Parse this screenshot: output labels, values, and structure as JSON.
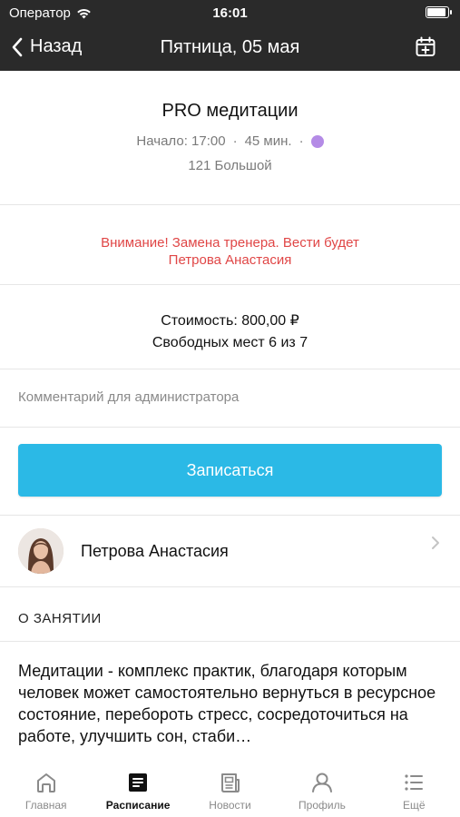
{
  "status_bar": {
    "carrier": "Оператор",
    "time": "16:01",
    "battery_level": 0.9
  },
  "nav": {
    "back_label": "Назад",
    "title": "Пятница, 05 мая"
  },
  "class_info": {
    "title": "PRO медитации",
    "start": "Начало: 17:00",
    "separator": "·",
    "duration": "45 мин.",
    "color": "#b48be6",
    "room": "121 Большой"
  },
  "warning": {
    "line1": "Внимание! Замена тренера. Вести будет",
    "line2": "Петрова Анастасия",
    "color": "#e04646"
  },
  "pricing": {
    "cost": "Стоимость: 800,00 ₽",
    "seats": "Свободных мест 6 из 7"
  },
  "comment": {
    "placeholder": "Комментарий для администратора"
  },
  "signup_button": {
    "label": "Записаться",
    "color": "#2bb9e6"
  },
  "trainer": {
    "name": "Петрова Анастасия",
    "avatar_icon": "trainer-photo"
  },
  "about": {
    "heading": "О ЗАНЯТИИ",
    "description": "Медитации -  комплекс практик, благодаря которым человек может самостоятельно вернуться в ресурсное состояние, перебороть стресс, сосредоточиться на работе, улучшить сон, стаби…"
  },
  "tabs": [
    {
      "label": "Главная",
      "icon": "home-icon",
      "active": false
    },
    {
      "label": "Расписание",
      "icon": "schedule-icon",
      "active": true
    },
    {
      "label": "Новости",
      "icon": "news-icon",
      "active": false
    },
    {
      "label": "Профиль",
      "icon": "profile-icon",
      "active": false
    },
    {
      "label": "Ещё",
      "icon": "more-icon",
      "active": false
    }
  ]
}
